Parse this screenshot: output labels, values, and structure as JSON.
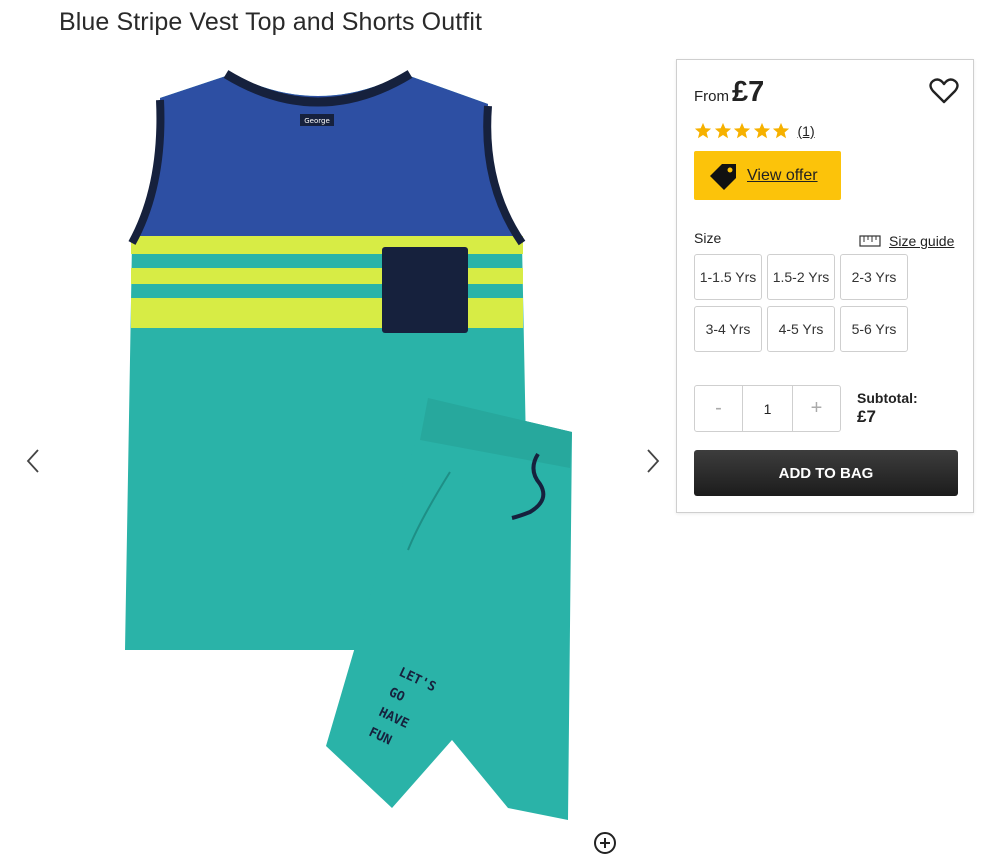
{
  "product": {
    "title": "Blue Stripe Vest Top and Shorts Outfit",
    "image_label": "George",
    "shorts_print": [
      "LET'S",
      "GO",
      "HAVE",
      "FUN"
    ]
  },
  "panel": {
    "from_label": "From",
    "price": "£7",
    "rating": {
      "stars": 5,
      "count_text": "(1)"
    },
    "offer_label": "View offer",
    "size_label": "Size",
    "size_guide_label": "Size guide",
    "sizes": [
      "1-1.5 Yrs",
      "1.5-2 Yrs",
      "2-3 Yrs",
      "3-4 Yrs",
      "4-5 Yrs",
      "5-6 Yrs"
    ],
    "quantity": {
      "minus": "-",
      "value": "1",
      "plus": "+"
    },
    "subtotal_label": "Subtotal:",
    "subtotal_value": "£7",
    "add_to_bag_label": "ADD TO BAG"
  },
  "colors": {
    "offer": "#fcc30a",
    "star": "#f6b100",
    "add_to_bag": "#222222",
    "vest_blue": "#2d4fa3",
    "teal": "#2ab3a8",
    "lime": "#d7ec45",
    "navy": "#16213d"
  },
  "icons": {
    "left": "chevron-left-icon",
    "right": "chevron-right-icon",
    "heart": "heart-icon",
    "tag": "price-tag-icon",
    "ruler": "ruler-icon",
    "zoom": "zoom-icon"
  }
}
